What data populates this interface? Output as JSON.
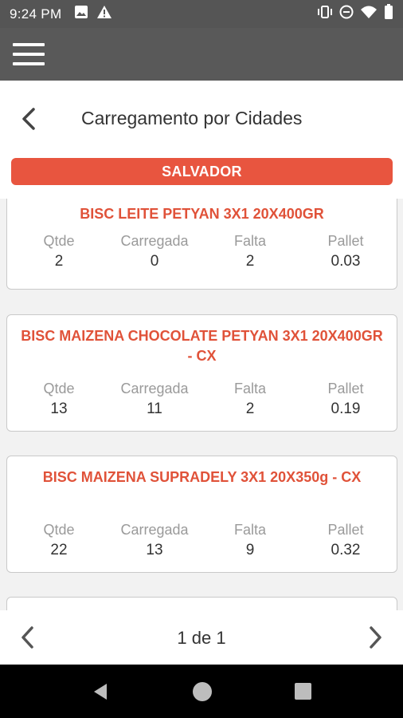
{
  "status_bar": {
    "time": "9:24 PM",
    "left_icons": [
      "image-icon",
      "warning-icon"
    ],
    "right_icons": [
      "vibrate-icon",
      "do-not-disturb-icon",
      "wifi-icon",
      "battery-icon"
    ]
  },
  "app_bar": {
    "menu_icon": "hamburger-menu-icon"
  },
  "header": {
    "title": "Carregamento por Cidades",
    "back_icon": "chevron-left-icon"
  },
  "city": {
    "name": "SALVADOR"
  },
  "columns": {
    "qtde": "Qtde",
    "carregada": "Carregada",
    "falta": "Falta",
    "pallet": "Pallet"
  },
  "products": [
    {
      "name": "BISC LEITE PETYAN 3X1 20X400GR",
      "qtde": "2",
      "carregada": "0",
      "falta": "2",
      "pallet": "0.03"
    },
    {
      "name": "BISC MAIZENA CHOCOLATE PETYAN 3X1 20X400GR - CX",
      "qtde": "13",
      "carregada": "11",
      "falta": "2",
      "pallet": "0.19"
    },
    {
      "name": "BISC MAIZENA SUPRADELY 3X1 20X350g - CX",
      "qtde": "22",
      "carregada": "13",
      "falta": "9",
      "pallet": "0.32"
    }
  ],
  "pagination": {
    "label": "1 de 1",
    "prev_icon": "chevron-left-icon",
    "next_icon": "chevron-right-icon"
  },
  "colors": {
    "accent": "#e8553f",
    "toolbar": "#595959",
    "status_bar": "#555555"
  }
}
